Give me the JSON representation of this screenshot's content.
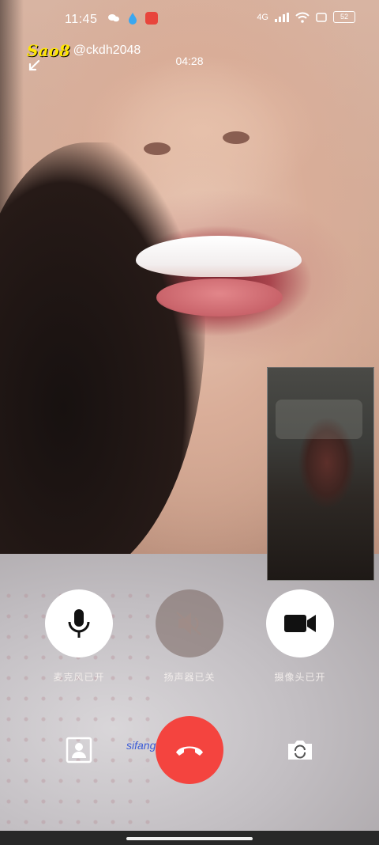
{
  "status_bar": {
    "time": "11:45",
    "network": "4G",
    "battery": "52"
  },
  "watermark": {
    "logo": "Sao8",
    "account": "@ckdh2048"
  },
  "call": {
    "duration": "04:28"
  },
  "controls": {
    "mic": {
      "label": "麦克风已开",
      "state": "on"
    },
    "speaker": {
      "label": "扬声器已关",
      "state": "off"
    },
    "camera": {
      "label": "摄像头已开",
      "state": "on"
    }
  },
  "site_watermark": "sifangds.net",
  "colors": {
    "hangup": "#f4443f",
    "button_on": "#ffffff",
    "watermark_logo": "#ffe600"
  }
}
